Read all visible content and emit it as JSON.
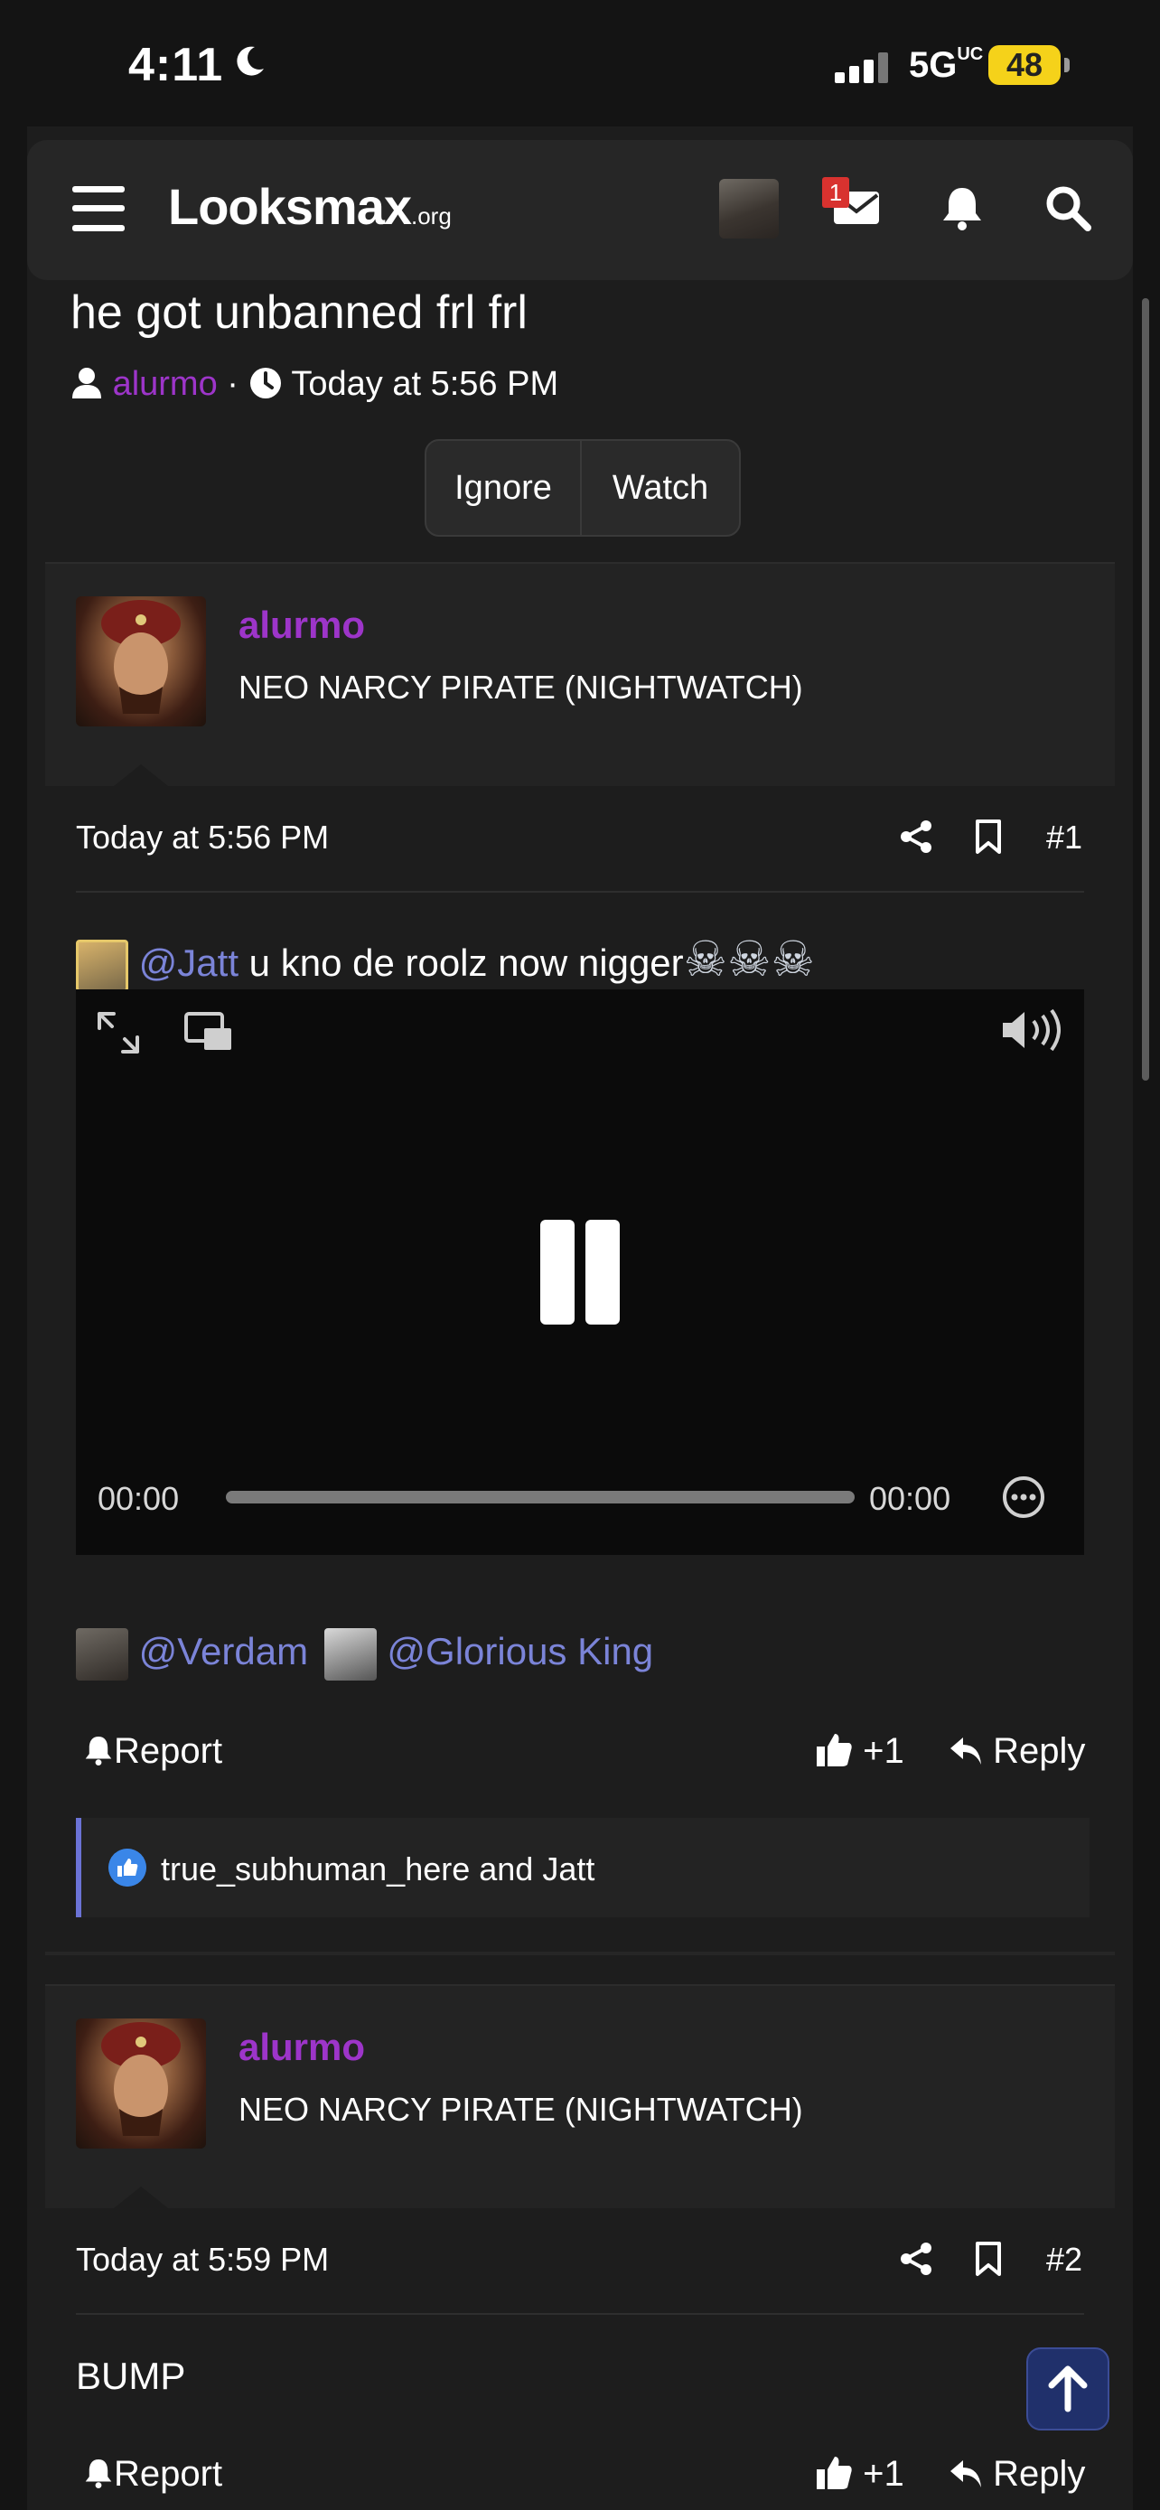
{
  "status_bar": {
    "time": "4:11",
    "network": "5G",
    "network_sup": "UC",
    "battery": "48"
  },
  "header": {
    "logo_main": "Looksmax",
    "logo_suffix": ".org",
    "mail_badge": "1"
  },
  "thread": {
    "title": "he got unbanned frl frl",
    "author": "alurmo",
    "separator": "·",
    "date": "Today at 5:56 PM",
    "buttons": {
      "ignore": "Ignore",
      "watch": "Watch"
    }
  },
  "posts": [
    {
      "author": "alurmo",
      "user_title": "NEO NARCY PIRATE (NIGHTWATCH)",
      "date": "Today at 5:56 PM",
      "number": "#1",
      "mention": "@Jatt",
      "text": " u kno de roolz now nigger",
      "emoji": "☠☠☠",
      "video": {
        "time_current": "00:00",
        "time_total": "00:00",
        "progress": 0
      },
      "mentions2": [
        "@Verdam",
        "@Glorious King"
      ],
      "report": "Report",
      "like": "+1",
      "reply": "Reply",
      "reactions": "true_subhuman_here and Jatt"
    },
    {
      "author": "alurmo",
      "user_title": "NEO NARCY PIRATE (NIGHTWATCH)",
      "date": "Today at 5:59 PM",
      "number": "#2",
      "text": "BUMP",
      "report": "Report",
      "like": "+1",
      "reply": "Reply"
    }
  ],
  "colors": {
    "accent_user": "#9d35c9",
    "mention": "#7b84d8",
    "background": "#1d1d1d",
    "badge": "#d8322f",
    "battery": "#f5d21a"
  },
  "icons": [
    "moon-icon",
    "signal-icon",
    "menu-icon",
    "user-avatar",
    "mail-icon",
    "bell-icon",
    "search-icon",
    "user-icon",
    "clock-icon",
    "share-icon",
    "bookmark-icon",
    "expand-icon",
    "pip-icon",
    "volume-icon",
    "pause-icon",
    "more-icon",
    "bell-report-icon",
    "thumbs-up-icon",
    "reply-icon",
    "like-reaction-icon",
    "arrow-up-icon"
  ]
}
